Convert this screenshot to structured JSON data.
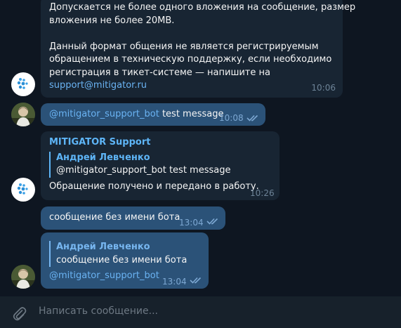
{
  "messages": {
    "m1": {
      "lines": [
        "Допускается не более одного вложения на сообщение, размер",
        "вложения не более 20MB.",
        "",
        "Данный формат общения не является регистрируемым",
        "обращением в техническую поддержку, если необходимо",
        "регистрация в тикет-системе — напишите на"
      ],
      "link": "support@mitigator.ru",
      "time": "10:06"
    },
    "m2": {
      "mention": "@mitigator_support_bot",
      "text": " test message",
      "time": "10:08"
    },
    "m3": {
      "sender": "MITIGATOR Support",
      "reply_author": "Андрей Левченко",
      "reply_text": "@mitigator_support_bot test message",
      "text": "Обращение получено и передано в работу.",
      "time": "10:26"
    },
    "m4": {
      "text": "сообщение без имени бота",
      "time": "13:04"
    },
    "m5": {
      "reply_author": "Андрей Левченко",
      "reply_text": "сообщение без имени бота",
      "mention": "@mitigator_support_bot",
      "time": "13:04"
    }
  },
  "composer": {
    "placeholder": "Написать сообщение..."
  },
  "icons": {
    "attach": "paperclip-icon",
    "read": "double-check-icon",
    "bot_avatar": "mitigator-logo-icon",
    "user_avatar": "user-photo-avatar"
  },
  "colors": {
    "background": "#0e1621",
    "incoming_bubble": "#182533",
    "outgoing_bubble": "#2b5278",
    "link": "#6ab3f3",
    "accent": "#5eb5f7"
  }
}
